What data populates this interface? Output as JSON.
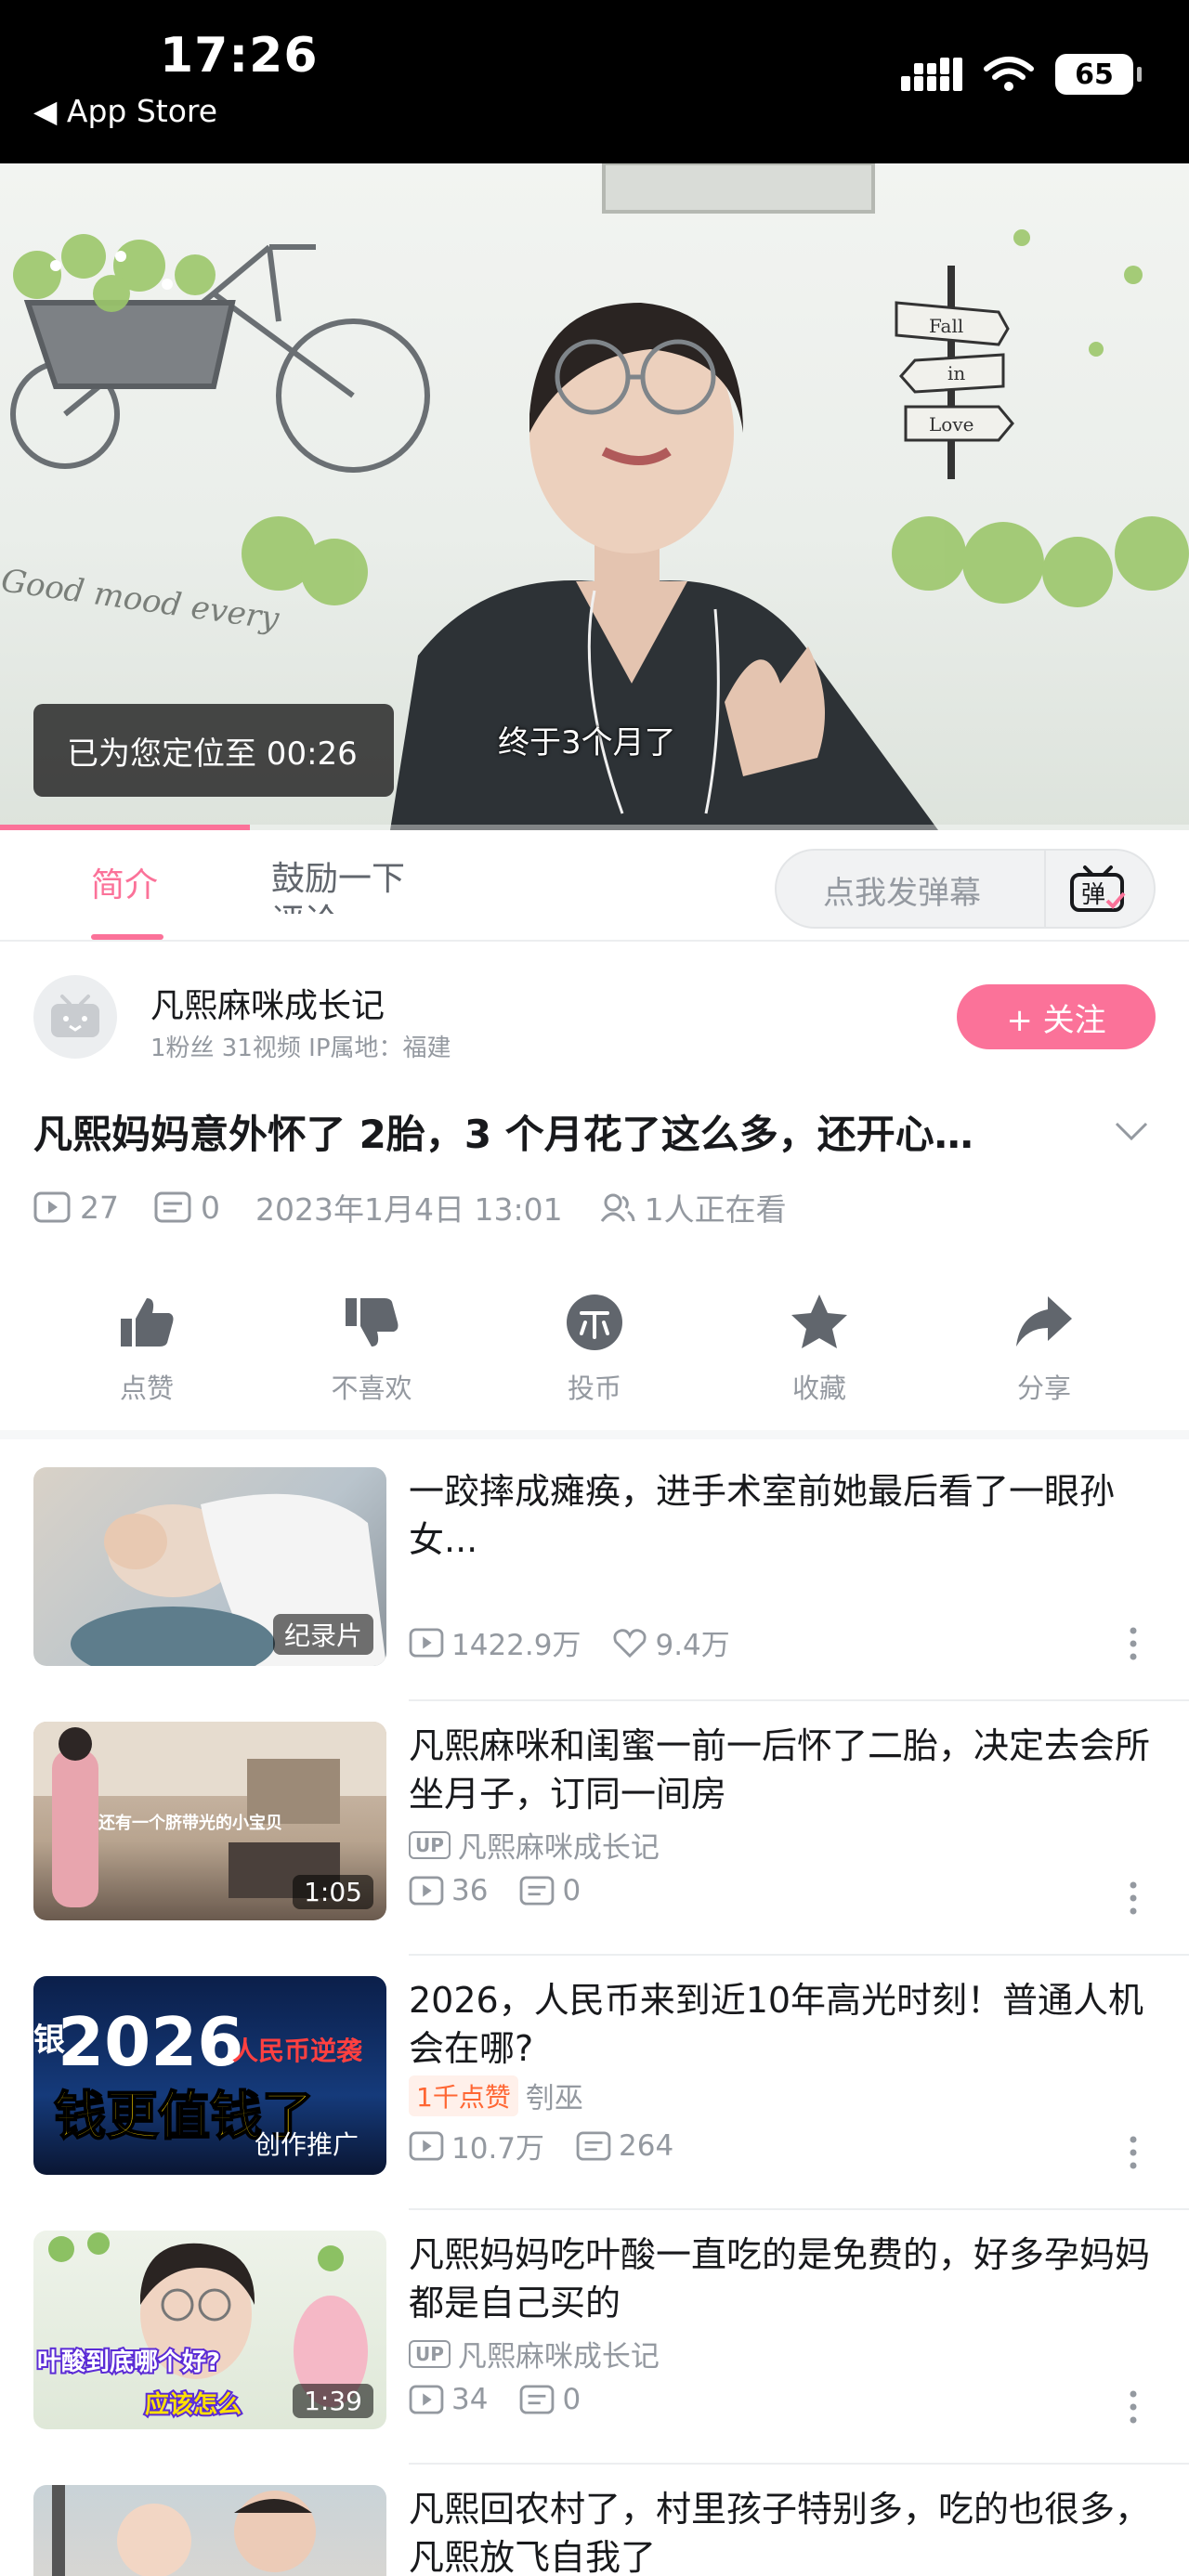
{
  "status_bar": {
    "time": "17:26",
    "back_label": "◀ App Store",
    "battery": "65"
  },
  "video": {
    "toast": "已为您定位至 00:26",
    "subtitle": "终于3个月了",
    "progress": 0.21,
    "scene_text": [
      "Fall",
      "in",
      "Love",
      "Good mood every"
    ]
  },
  "tabs": {
    "intro": "简介",
    "comments": "鼓励一下评论",
    "danmaku_placeholder": "点我发弹幕",
    "danmaku_icon_text": "弹"
  },
  "uploader": {
    "name": "凡熙麻咪成长记",
    "meta": "1粉丝   31视频   IP属地：福建",
    "follow_label": "+ 关注"
  },
  "video_info": {
    "title": "凡熙妈妈意外怀了 2胎，3 个月花了这么多，还开心…",
    "plays": "27",
    "danmaku": "0",
    "date": "2023年1月4日 13:01",
    "watching": "1人正在看"
  },
  "actions": [
    {
      "label": "点赞",
      "icon": "thumb-up-icon"
    },
    {
      "label": "不喜欢",
      "icon": "thumb-down-icon"
    },
    {
      "label": "投币",
      "icon": "coin-icon"
    },
    {
      "label": "收藏",
      "icon": "star-icon"
    },
    {
      "label": "分享",
      "icon": "share-icon"
    }
  ],
  "feed": [
    {
      "title": "一跤摔成瘫痪，进手术室前她最后看了一眼孙女...",
      "badge": "纪录片",
      "plays": "1422.9万",
      "likes": "9.4万"
    },
    {
      "title": "凡熙麻咪和闺蜜一前一后怀了二胎，决定去会所坐月子，订同一间房",
      "badge": "1:05",
      "thumb_caption": "还有一个脐带光的小宝贝",
      "up_tag": "UP",
      "author": "凡熙麻咪成长记",
      "plays": "36",
      "danmaku": "0"
    },
    {
      "title": "2026，人民币来到近10年高光时刻！普通人机会在哪?",
      "badge": "创作推广",
      "thumb_big": "2026",
      "thumb_small": "人民币逆袭",
      "thumb_line2": "钱更值钱了",
      "thumb_prefix": "银",
      "hot_tag": "1千点赞",
      "author": "刳巫",
      "plays": "10.7万",
      "danmaku": "264"
    },
    {
      "title": "凡熙妈妈吃叶酸一直吃的是免费的，好多孕妈妈都是自己买的",
      "badge": "1:39",
      "thumb_caption": "叶酸到底哪个好?",
      "thumb_caption2": "应该怎么",
      "up_tag": "UP",
      "author": "凡熙麻咪成长记",
      "plays": "34",
      "danmaku": "0"
    },
    {
      "title": "凡熙回农村了，村里孩子特别多，吃的也很多，凡熙放飞自我了"
    }
  ],
  "colors": {
    "accent": "#fb7299",
    "muted": "#9499a0",
    "text": "#18191c"
  }
}
